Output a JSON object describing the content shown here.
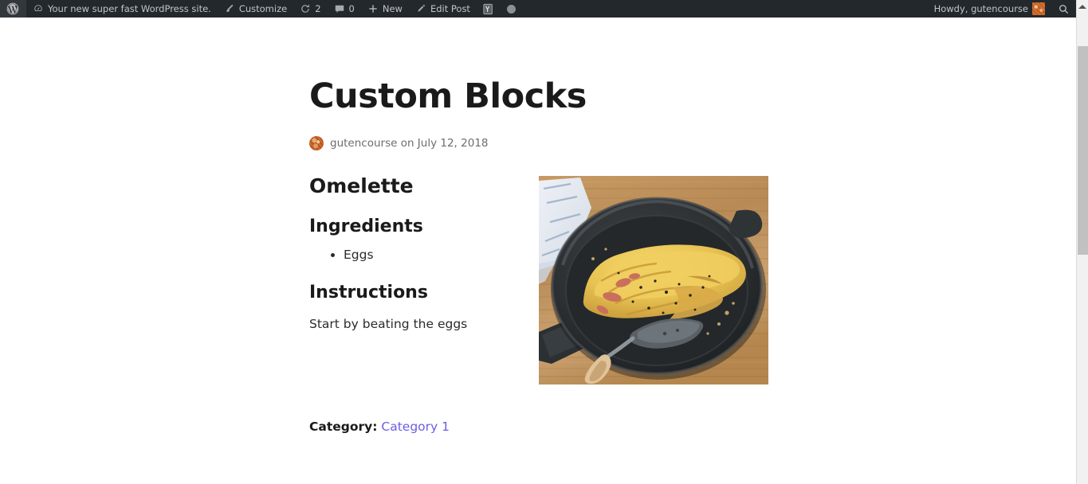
{
  "adminbar": {
    "left_items": [
      {
        "name": "wordpress-logo",
        "icon": "wordpress-icon",
        "label": ""
      },
      {
        "name": "site-name",
        "icon": "dashboard-icon",
        "label": "Your new super fast WordPress site."
      },
      {
        "name": "customize",
        "icon": "paintbrush-icon",
        "label": "Customize"
      },
      {
        "name": "updates",
        "icon": "update-icon",
        "label": "2"
      },
      {
        "name": "comments",
        "icon": "comment-bubble-icon",
        "label": "0"
      },
      {
        "name": "new-content",
        "icon": "plus-icon",
        "label": "New"
      },
      {
        "name": "edit-post",
        "icon": "pencil-icon",
        "label": "Edit Post"
      },
      {
        "name": "yoast-seo",
        "icon": "yoast-icon",
        "label": ""
      },
      {
        "name": "seo-status",
        "icon": "circle-icon",
        "label": ""
      }
    ],
    "howdy": "Howdy, gutencourse",
    "search_icon": "search-icon"
  },
  "post": {
    "title": "Custom Blocks",
    "byline": "gutencourse on July 12, 2018",
    "author": "gutencourse",
    "date": "July 12, 2018",
    "recipe_title": "Omelette",
    "ingredients_heading": "Ingredients",
    "ingredients": [
      "Eggs"
    ],
    "instructions_heading": "Instructions",
    "instructions": "Start by beating the eggs",
    "image_alt": "Omelette cooking in a black skillet on a wooden table",
    "category_label": "Category:",
    "category_link": "Category 1"
  },
  "colors": {
    "adminbar_bg": "#23282d",
    "adminbar_text": "#c3c4c7",
    "link": "#6b5ce7",
    "heading": "#1a1a1a",
    "body_text": "#2b2b2b",
    "muted_text": "#6d6d6d",
    "gravatar": "#bd5b22"
  }
}
